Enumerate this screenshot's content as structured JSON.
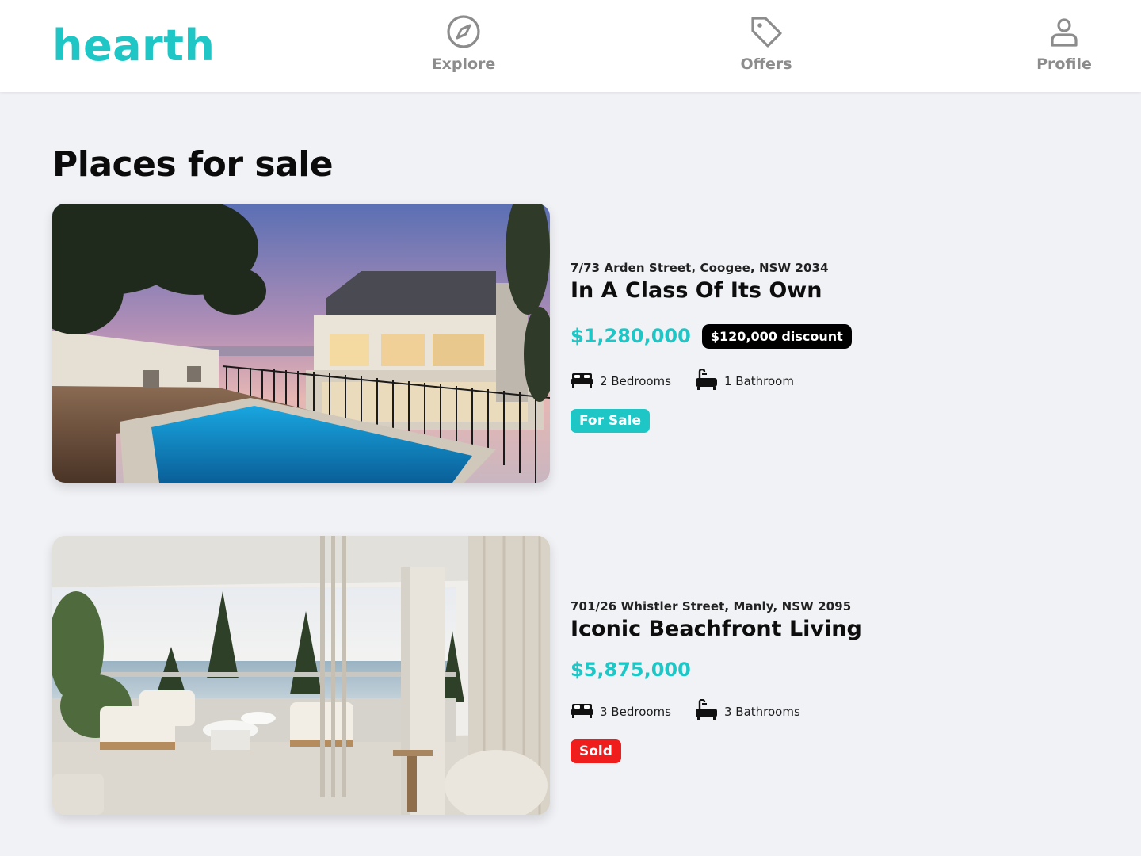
{
  "brand": {
    "name": "hearth",
    "color": "#1fc6c6"
  },
  "nav": {
    "items": [
      {
        "label": "Explore",
        "icon": "compass-icon"
      },
      {
        "label": "Offers",
        "icon": "tag-icon"
      },
      {
        "label": "Profile",
        "icon": "user-icon"
      }
    ]
  },
  "page": {
    "title": "Places for sale"
  },
  "listings": [
    {
      "address": "7/73 Arden Street, Coogee, NSW 2034",
      "title": "In A Class Of Its Own",
      "price": "$1,280,000",
      "discount": "$120,000 discount",
      "bedrooms": "2 Bedrooms",
      "bathrooms": "1 Bathroom",
      "status": "For Sale",
      "status_color": "#1fc6c6",
      "photo": "house-with-pool-at-dusk"
    },
    {
      "address": "701/26 Whistler Street, Manly, NSW 2095",
      "title": "Iconic Beachfront Living",
      "price": "$5,875,000",
      "bedrooms": "3 Bedrooms",
      "bathrooms": "3 Bathrooms",
      "status": "Sold",
      "status_color": "#f01d1d",
      "photo": "beachfront-balcony-interior"
    }
  ],
  "colors": {
    "accent": "#1fc6c6",
    "nav_text": "#8c8c8c",
    "background": "#f1f2f6",
    "sold": "#f01d1d"
  }
}
